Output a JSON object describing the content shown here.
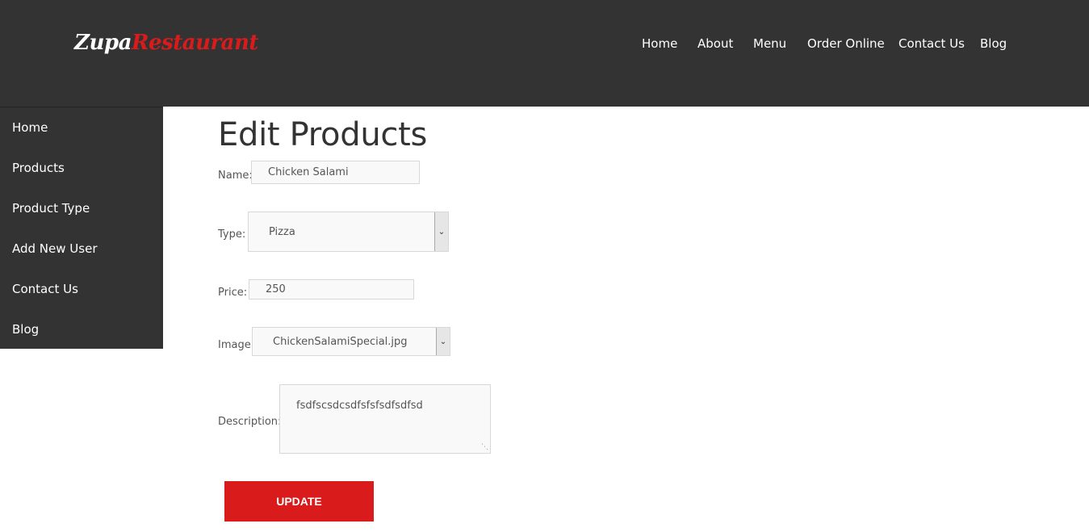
{
  "logo": {
    "part1": "Zupa",
    "part2": "Restaurant"
  },
  "topnav": [
    "Home",
    "About",
    "Menu",
    "Order Online",
    "Contact Us",
    "Blog"
  ],
  "sidebar": [
    "Home",
    "Products",
    "Product Type",
    "Add New User",
    "Contact Us",
    "Blog"
  ],
  "page_title": "Edit Products",
  "form": {
    "name_label": "Name:",
    "name_value": "Chicken Salami",
    "type_label": "Type:",
    "type_value": "Pizza",
    "price_label": "Price:",
    "price_value": "250",
    "image_label": "Image:",
    "image_value": "ChickenSalamiSpecial.jpg",
    "description_label": "Description:",
    "description_value": "fsdfscsdcsdfsfsfsdfsdfsd",
    "update_label": "UPDATE"
  },
  "colors": {
    "header_bg": "#333333",
    "accent": "#d91b1b"
  }
}
